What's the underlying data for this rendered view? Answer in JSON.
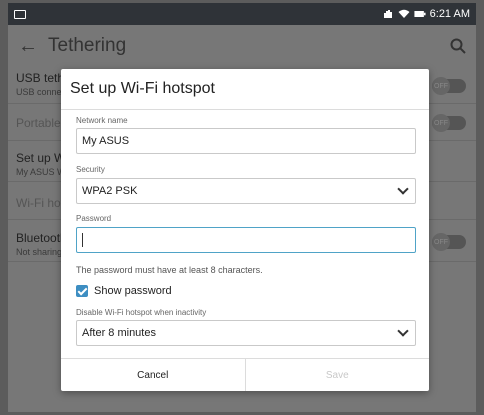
{
  "status_bar": {
    "time": "6:21 AM"
  },
  "app_bar": {
    "title": "Tethering"
  },
  "background": {
    "rows": [
      {
        "title": "USB tethe",
        "subtitle": "USB conne",
        "toggle": "OFF"
      },
      {
        "title": "Portable",
        "subtitle": "",
        "toggle": "OFF"
      },
      {
        "title": "Set up Wi",
        "subtitle": "My ASUS W",
        "toggle": ""
      },
      {
        "title": "Wi-Fi hot",
        "subtitle": "",
        "toggle": ""
      },
      {
        "title": "Bluetooth",
        "subtitle": "Not sharing",
        "toggle": "OFF"
      }
    ]
  },
  "dialog": {
    "title": "Set up Wi-Fi hotspot",
    "network_name_label": "Network name",
    "network_name_value": "My ASUS",
    "security_label": "Security",
    "security_value": "WPA2 PSK",
    "password_label": "Password",
    "password_value": "",
    "password_hint": "The password must have at least 8 characters.",
    "show_password_label": "Show password",
    "show_password_checked": true,
    "disable_label": "Disable Wi-Fi hotspot when inactivity",
    "disable_value": "After 8 minutes",
    "cancel_label": "Cancel",
    "save_label": "Save"
  },
  "colors": {
    "accent": "#3d8ec2",
    "active_field_border": "#4fa3c7"
  }
}
